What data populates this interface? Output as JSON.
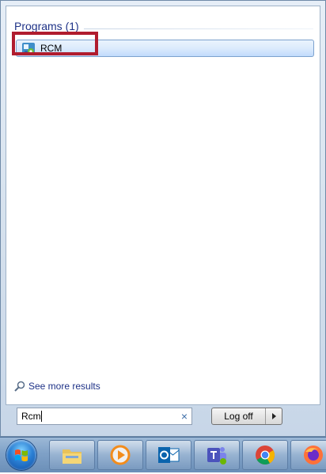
{
  "start_menu": {
    "section_heading": "Programs (1)",
    "programs": [
      {
        "label": "RCM",
        "icon": "rcm-app-icon",
        "highlighted": true
      }
    ],
    "see_more_label": "See more results",
    "search": {
      "value": "Rcm",
      "clear_icon": "×"
    },
    "logoff_label": "Log off"
  },
  "taskbar": {
    "start_button_icon": "windows-start-orb",
    "pinned": [
      {
        "name": "file-explorer",
        "icon": "folder-icon"
      },
      {
        "name": "media-player",
        "icon": "media-player-icon"
      },
      {
        "name": "outlook",
        "icon": "outlook-icon"
      },
      {
        "name": "teams",
        "icon": "teams-icon"
      },
      {
        "name": "chrome",
        "icon": "chrome-icon"
      },
      {
        "name": "firefox",
        "icon": "firefox-icon"
      }
    ]
  },
  "colors": {
    "highlight_border": "#b01c2e",
    "heading_text": "#1e3287",
    "selection_fill": "#dcebfc"
  }
}
